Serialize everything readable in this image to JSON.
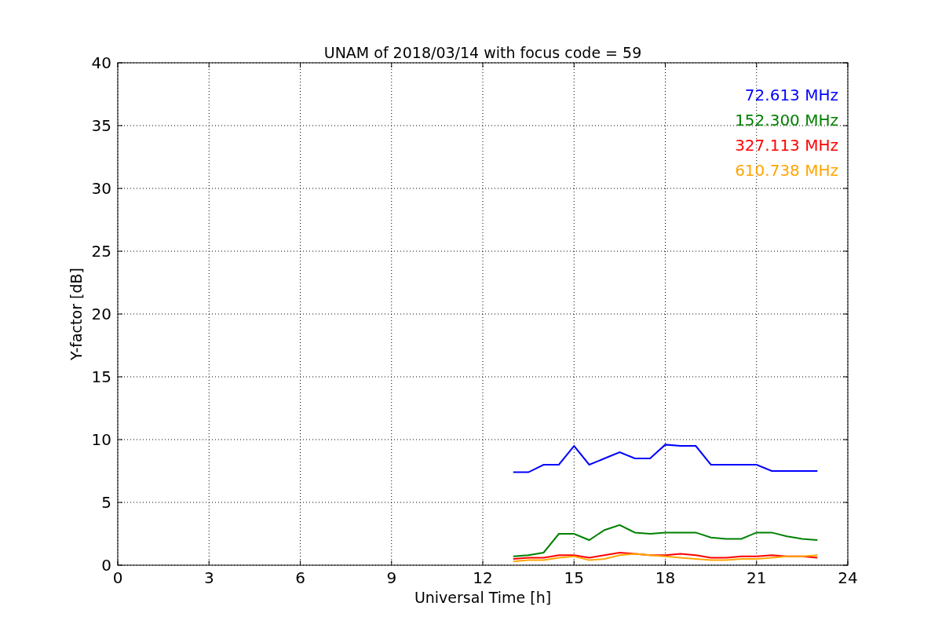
{
  "figure": {
    "chart_data": {
      "type": "line",
      "title": "UNAM of 2018/03/14 with focus code = 59",
      "xlabel": "Universal Time [h]",
      "ylabel": "Y-factor [dB]",
      "x": [
        13,
        13.5,
        14,
        14.5,
        15,
        15.5,
        16,
        16.5,
        17,
        17.5,
        18,
        18.5,
        19,
        19.5,
        20,
        20.5,
        21,
        21.5,
        22,
        22.5,
        23
      ],
      "series": [
        {
          "name": "72.613 MHz",
          "color": "#0000ff",
          "values": [
            7.4,
            7.4,
            8,
            8,
            9.5,
            8,
            8.5,
            9,
            8.5,
            8.5,
            9.6,
            9.5,
            9.5,
            8,
            8,
            8,
            8,
            7.5,
            7.5,
            7.5,
            7.5
          ]
        },
        {
          "name": "152.300 MHz",
          "color": "#008000",
          "values": [
            0.7,
            0.8,
            1,
            2.5,
            2.5,
            2,
            2.8,
            3.2,
            2.6,
            2.5,
            2.6,
            2.6,
            2.6,
            2.2,
            2.1,
            2.1,
            2.6,
            2.6,
            2.3,
            2.1,
            2
          ]
        },
        {
          "name": "327.113 MHz",
          "color": "#ff0000",
          "values": [
            0.5,
            0.6,
            0.6,
            0.8,
            0.8,
            0.6,
            0.8,
            1,
            0.9,
            0.8,
            0.8,
            0.9,
            0.8,
            0.6,
            0.6,
            0.7,
            0.7,
            0.8,
            0.7,
            0.7,
            0.6
          ]
        },
        {
          "name": "610.738 MHz",
          "color": "#ffa500",
          "values": [
            0.3,
            0.4,
            0.4,
            0.6,
            0.7,
            0.4,
            0.5,
            0.8,
            0.9,
            0.8,
            0.7,
            0.6,
            0.5,
            0.4,
            0.4,
            0.5,
            0.5,
            0.6,
            0.7,
            0.7,
            0.8
          ]
        }
      ],
      "grid": true,
      "xlim": [
        0,
        24
      ],
      "ylim": [
        0,
        40
      ],
      "xticks": [
        0,
        3,
        6,
        9,
        12,
        15,
        18,
        21,
        24
      ],
      "yticks": [
        0,
        5,
        10,
        15,
        20,
        25,
        30,
        35,
        40
      ]
    }
  }
}
